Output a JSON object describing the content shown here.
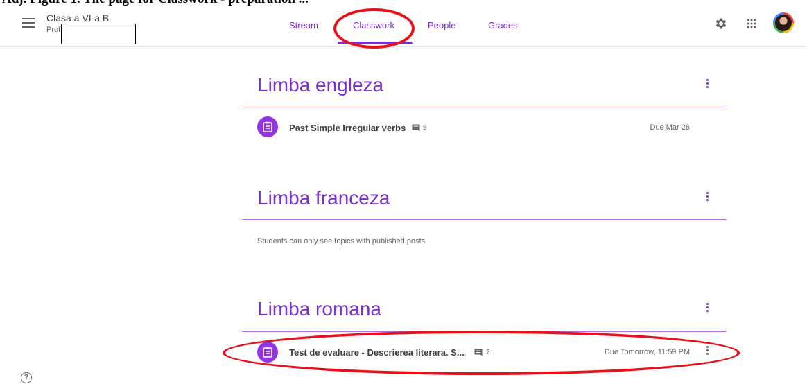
{
  "top_caption": "Adj. Figure 1.  The page for Classwork  - preparation ...",
  "header": {
    "class_name": "Clasa a VI-a B",
    "subtitle": "Prof"
  },
  "tabs": [
    {
      "label": "Stream"
    },
    {
      "label": "Classwork"
    },
    {
      "label": "People"
    },
    {
      "label": "Grades"
    }
  ],
  "active_tab": "Classwork",
  "topics": [
    {
      "title": "Limba engleza",
      "items": [
        {
          "title": "Past Simple Irregular verbs",
          "comments": "5",
          "due": "Due Mar 26"
        }
      ]
    },
    {
      "title": "Limba franceza",
      "empty_note": "Students can only see topics with published posts"
    },
    {
      "title": "Limba romana",
      "items": [
        {
          "title": "Test de evaluare - Descrierea literara. S...",
          "comments": "2",
          "due": "Due Tomorrow, 11:59 PM"
        }
      ]
    }
  ],
  "help_glyph": "?",
  "colors": {
    "accent": "#7b2fcf",
    "annotation": "#e8101a",
    "assignment_icon": "#9334e6"
  },
  "icons": [
    "menu-icon",
    "settings-icon",
    "apps-icon",
    "avatar",
    "assignment-icon",
    "comment-icon",
    "more-vert-icon",
    "help-icon"
  ]
}
